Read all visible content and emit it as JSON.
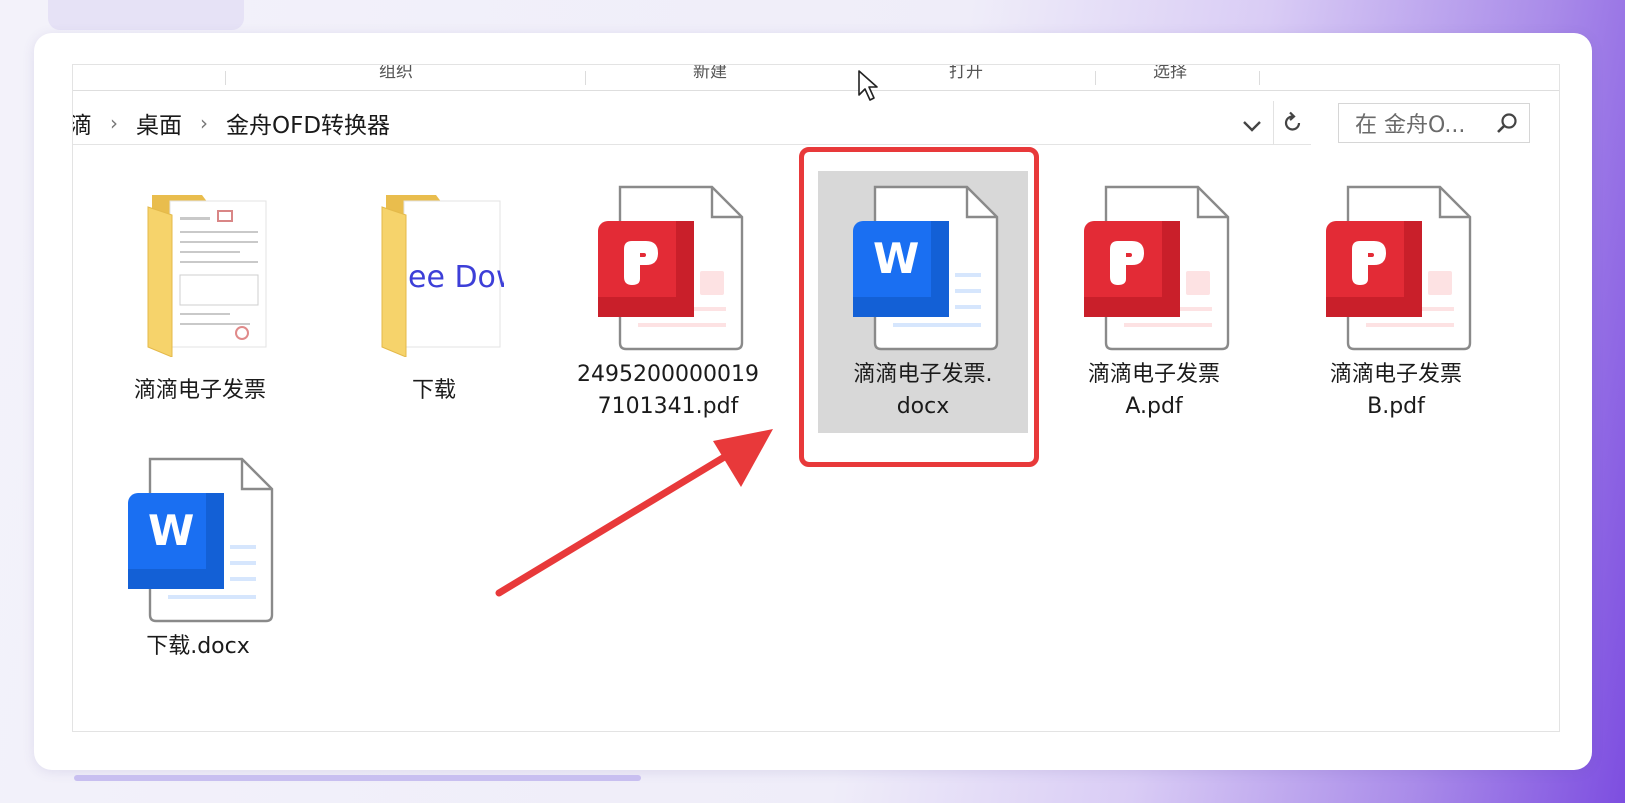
{
  "ribbon": {
    "items": [
      "组织",
      "新建",
      "打开",
      "选择"
    ]
  },
  "address": {
    "crumbs": [
      "滴",
      "桌面",
      "金舟OFD转换器"
    ]
  },
  "search": {
    "placeholder": "在 金舟O..."
  },
  "files": [
    {
      "name_line1": "滴滴电子发票",
      "name_line2": "",
      "type": "folder-icon",
      "preview_text": ""
    },
    {
      "name_line1": "下载",
      "name_line2": "",
      "type": "folder-icon",
      "preview_text": "ee Dow"
    },
    {
      "name_line1": "2495200000019",
      "name_line2": "7101341.pdf",
      "type": "pdf-file-icon"
    },
    {
      "name_line1": "滴滴电子发票.",
      "name_line2": "docx",
      "type": "word-file-icon",
      "selected": true
    },
    {
      "name_line1": "滴滴电子发票",
      "name_line2": "A.pdf",
      "type": "pdf-file-icon"
    },
    {
      "name_line1": "滴滴电子发票",
      "name_line2": "B.pdf",
      "type": "pdf-file-icon"
    },
    {
      "name_line1": "下载.docx",
      "name_line2": "",
      "type": "word-file-icon"
    }
  ],
  "colors": {
    "pdf_red": "#e32b36",
    "word_blue": "#1a6ff2",
    "highlight": "#e8393a",
    "folder_yellow": "#f6d36b"
  }
}
